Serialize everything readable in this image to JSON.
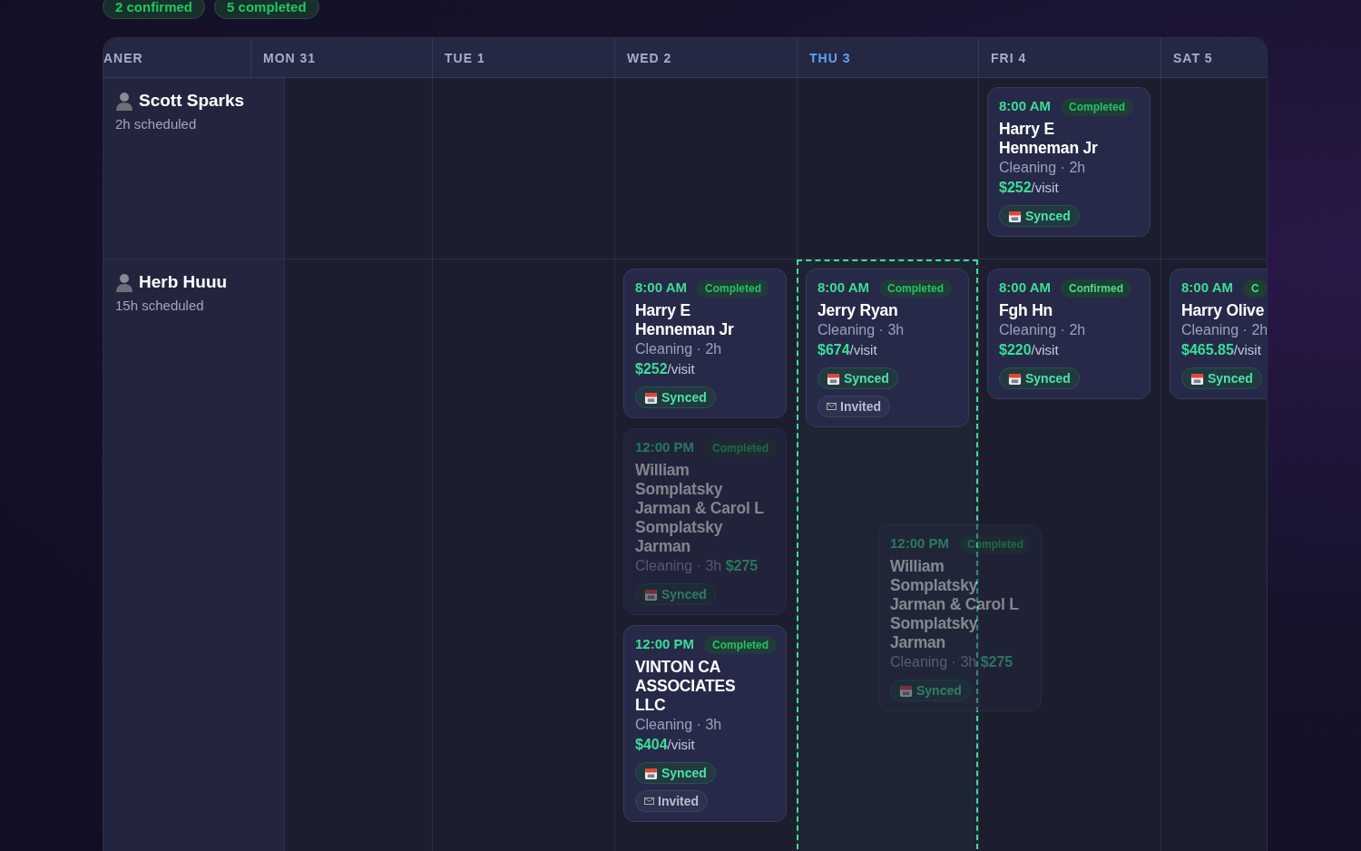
{
  "summary_pills": [
    {
      "label": "2 confirmed"
    },
    {
      "label": "5 completed"
    }
  ],
  "header": [
    {
      "label": "ANER",
      "selected": false
    },
    {
      "label": "MON 31",
      "selected": false
    },
    {
      "label": "TUE 1",
      "selected": false
    },
    {
      "label": "WED 2",
      "selected": false
    },
    {
      "label": "THU 3",
      "selected": true
    },
    {
      "label": "FRI 4",
      "selected": false
    },
    {
      "label": "SAT 5",
      "selected": false
    }
  ],
  "rows": [
    {
      "cleaner": {
        "name": "Scott Sparks",
        "hours": "2h scheduled"
      },
      "days": [
        {
          "drop_target": false
        },
        {
          "drop_target": false
        },
        {
          "drop_target": false
        },
        {
          "drop_target": false
        },
        {
          "drop_target": false,
          "cards": [
            {
              "time": "8:00 AM",
              "status": {
                "kind": "completed",
                "label": "Completed"
              },
              "name": "Harry E Henneman Jr",
              "service": "Cleaning · 2h",
              "price": "$252",
              "unit": "/visit",
              "faded": false,
              "badges": [
                {
                  "kind": "synced",
                  "label": "Synced"
                }
              ]
            }
          ]
        },
        {
          "drop_target": false
        }
      ]
    },
    {
      "cleaner": {
        "name": "Herb Huuu",
        "hours": "15h scheduled"
      },
      "days": [
        {
          "drop_target": false
        },
        {
          "drop_target": false
        },
        {
          "drop_target": false,
          "cards": [
            {
              "time": "8:00 AM",
              "status": {
                "kind": "completed",
                "label": "Completed"
              },
              "name": "Harry E Henneman Jr",
              "service": "Cleaning · 2h",
              "price": "$252",
              "unit": "/visit",
              "faded": false,
              "badges": [
                {
                  "kind": "synced",
                  "label": "Synced"
                }
              ]
            },
            {
              "time": "12:00 PM",
              "status": {
                "kind": "completed",
                "label": "Completed"
              },
              "name": "William Somplatsky Jarman & Carol L Somplatsky Jarman",
              "service": "Cleaning · 3h",
              "price": "$275",
              "faded": true,
              "badges": [
                {
                  "kind": "synced",
                  "label": "Synced"
                }
              ]
            },
            {
              "time": "12:00 PM",
              "status": {
                "kind": "completed",
                "label": "Completed"
              },
              "name": "VINTON CA ASSOCIATES LLC",
              "service": "Cleaning · 3h",
              "price": "$404",
              "unit": "/visit",
              "faded": false,
              "badges": [
                {
                  "kind": "synced",
                  "label": "Synced"
                },
                {
                  "kind": "invited",
                  "label": "Invited"
                }
              ]
            }
          ]
        },
        {
          "drop_target": true,
          "cards": [
            {
              "time": "8:00 AM",
              "status": {
                "kind": "completed",
                "label": "Completed"
              },
              "name": "Jerry Ryan",
              "service": "Cleaning · 3h",
              "price": "$674",
              "unit": "/visit",
              "faded": false,
              "badges": [
                {
                  "kind": "synced",
                  "label": "Synced"
                },
                {
                  "kind": "invited",
                  "label": "Invited"
                }
              ]
            }
          ],
          "drag_preview": {
            "time": "12:00 PM",
            "status": {
              "kind": "completed",
              "label": "Completed"
            },
            "name": "William Somplatsky Jarman & Carol L Somplatsky Jarman",
            "service": "Cleaning · 3h",
            "price": "$275",
            "faded": true,
            "badges": [
              {
                "kind": "synced",
                "label": "Synced"
              }
            ]
          }
        },
        {
          "drop_target": false,
          "cards": [
            {
              "time": "8:00 AM",
              "status": {
                "kind": "confirmed",
                "label": "Confirmed"
              },
              "name": "Fgh Hn",
              "service": "Cleaning · 2h",
              "price": "$220",
              "unit": "/visit",
              "faded": false,
              "badges": [
                {
                  "kind": "synced",
                  "label": "Synced"
                }
              ]
            }
          ]
        },
        {
          "drop_target": false,
          "cards": [
            {
              "time": "8:00 AM",
              "status": {
                "kind": "confirmed",
                "label": "C"
              },
              "name": "Harry Olive",
              "service": "Cleaning · 2h",
              "price": "$465.85",
              "unit": "/visit",
              "faded": false,
              "badges": [
                {
                  "kind": "synced",
                  "label": "Synced"
                }
              ]
            }
          ]
        }
      ]
    }
  ]
}
